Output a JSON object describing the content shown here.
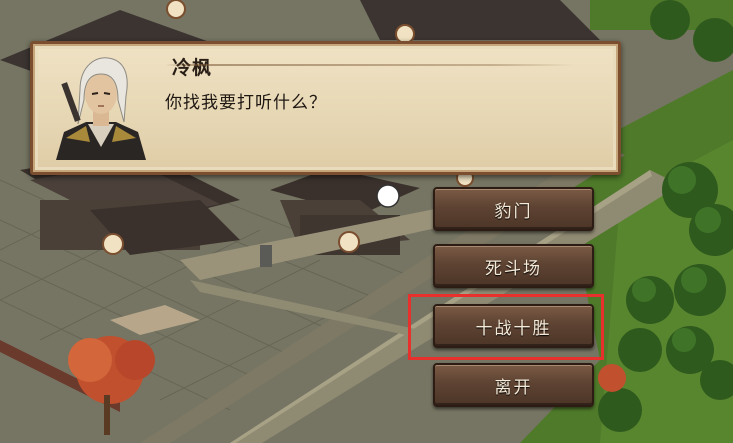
{
  "dialog": {
    "speaker": "冷枫",
    "message": "你找我要打听什么？"
  },
  "menu": {
    "items": [
      {
        "label": "豹门"
      },
      {
        "label": "死斗场"
      },
      {
        "label": "十战十胜",
        "highlighted": true
      },
      {
        "label": "离开"
      }
    ]
  },
  "colors": {
    "highlight_border": "#e8302d",
    "dialog_bg": "#ecdfc0",
    "button_bg": "#5e4333"
  }
}
